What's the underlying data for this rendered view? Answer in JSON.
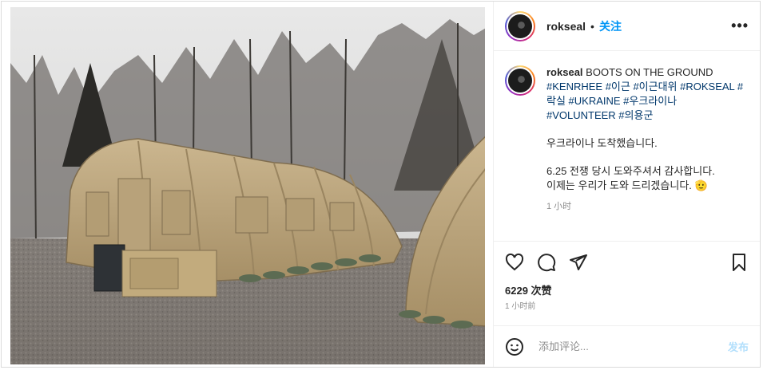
{
  "post": {
    "username": "rokseal",
    "follow_label": "关注",
    "more_label": "•••",
    "caption": {
      "username": "rokseal",
      "text": "BOOTS ON THE GROUND",
      "hashtags": "#KENRHEE #이근 #이근대위 #ROKSEAL #락실 #UKRAINE #우크라이나 #VOLUNTEER #의용군",
      "line1": "우크라이나 도착했습니다.",
      "line2": "6.25 전쟁 당시 도와주셔서 감사합니다.",
      "line3": "이제는 우리가 도와 드리겠습니다. 🫡",
      "time": "1 小时"
    },
    "likes": "6229 次赞",
    "posted_time": "1 小时前",
    "comment_placeholder": "添加评论...",
    "publish_label": "发布"
  },
  "icons": {
    "avatar": "profile-avatar",
    "like": "heart-icon",
    "comment": "comment-icon",
    "share": "share-icon",
    "save": "bookmark-icon",
    "emoji": "emoji-icon"
  },
  "colors": {
    "link": "#0095f6",
    "hashtag": "#00376b",
    "muted": "#8e8e8e",
    "publish_disabled": "#b2dffc",
    "tent": "#c2aa7e"
  }
}
